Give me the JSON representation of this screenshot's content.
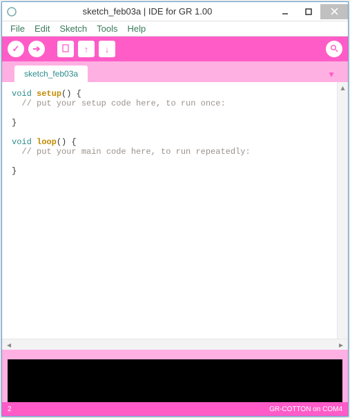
{
  "window": {
    "title": "sketch_feb03a | IDE for GR 1.00"
  },
  "menubar": {
    "file": "File",
    "edit": "Edit",
    "sketch": "Sketch",
    "tools": "Tools",
    "help": "Help"
  },
  "tabs": {
    "active": "sketch_feb03a"
  },
  "code": {
    "l1_kw": "void",
    "l1_fn": "setup",
    "l1_rest": "() {",
    "l2_cm": "  // put your setup code here, to run once:",
    "l3": "",
    "l4": "}",
    "l5": "",
    "l6_kw": "void",
    "l6_fn": "loop",
    "l6_rest": "() {",
    "l7_cm": "  // put your main code here, to run repeatedly:",
    "l8": "",
    "l9": "}"
  },
  "status": {
    "line": "2",
    "board": "GR-COTTON on COM4"
  },
  "colors": {
    "accent": "#ff5cc8",
    "accent_light": "#ffb0e3"
  }
}
